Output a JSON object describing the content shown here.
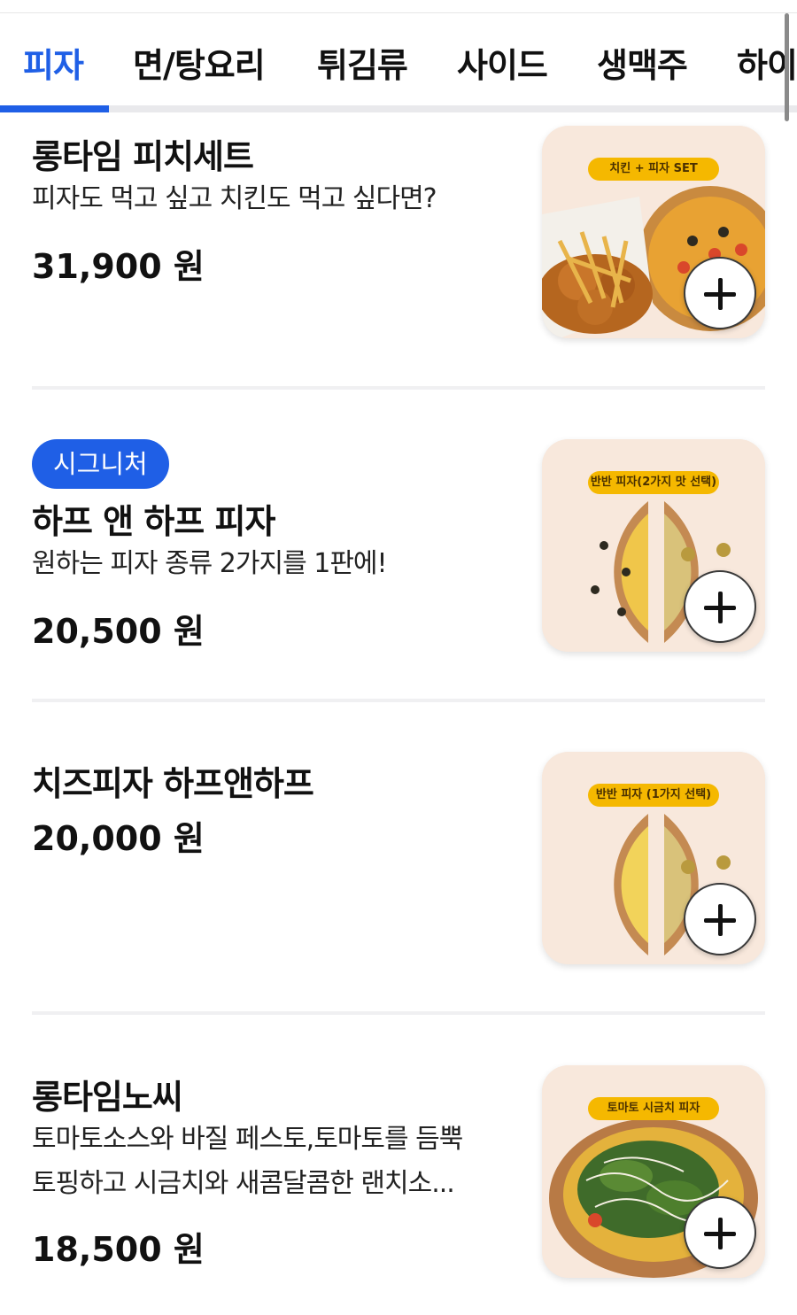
{
  "tabs": [
    {
      "label": "피자",
      "active": true
    },
    {
      "label": "면/탕요리",
      "active": false
    },
    {
      "label": "튀김류",
      "active": false
    },
    {
      "label": "사이드",
      "active": false
    },
    {
      "label": "생맥주",
      "active": false
    },
    {
      "label": "하이",
      "active": false
    }
  ],
  "accent_color": "#1f5fe6",
  "add_icon": "plus-icon",
  "menu": [
    {
      "name": "롱타임 피치세트",
      "description": [
        "피자도 먹고 싶고 치킨도 먹고 싶다면?"
      ],
      "price": "31,900 원",
      "image_tag": "치킨 + 피자 SET"
    },
    {
      "badge": "시그니처",
      "name": "하프 앤 하프 피자",
      "description": [
        "원하는 피자 종류 2가지를 1판에!"
      ],
      "price": "20,500 원",
      "image_tag": "반반 피자(2가지 맛 선택)"
    },
    {
      "name": "치즈피자 하프앤하프",
      "price": "20,000 원",
      "image_tag": "반반 피자 (1가지 선택)"
    },
    {
      "name": "롱타임노씨",
      "description": [
        "토마토소스와 바질 페스토,토마토를 듬뿍",
        "토핑하고 시금치와 새콤달콤한 랜치소..."
      ],
      "price": "18,500 원",
      "image_tag": "토마토 시금치 피자"
    }
  ]
}
